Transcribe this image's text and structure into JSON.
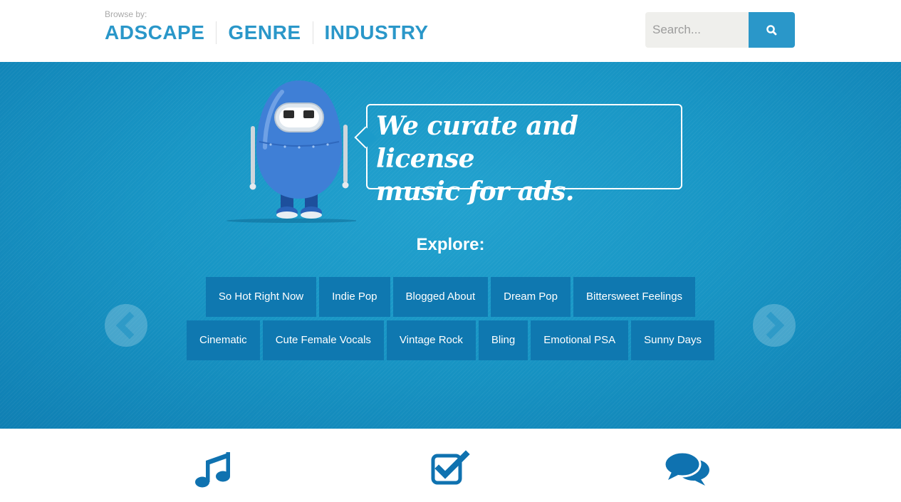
{
  "header": {
    "browse_label": "Browse by:",
    "nav": [
      "ADSCAPE",
      "GENRE",
      "INDUSTRY"
    ],
    "search": {
      "placeholder": "Search...",
      "button_icon": "search-icon"
    }
  },
  "hero": {
    "tagline_line1": "We curate and license",
    "tagline_line2": "music for ads.",
    "explore_label": "Explore:",
    "tags_row1": [
      "So Hot Right Now",
      "Indie Pop",
      "Blogged About",
      "Dream Pop",
      "Bittersweet Feelings"
    ],
    "tags_row2": [
      "Cinematic",
      "Cute Female Vocals",
      "Vintage Rock",
      "Bling",
      "Emotional PSA",
      "Sunny Days"
    ],
    "prev_icon": "chevron-left-icon",
    "next_icon": "chevron-right-icon",
    "mascot_icon": "robot-mascot"
  },
  "features": {
    "icons": [
      "music-note-icon",
      "checkbox-icon",
      "chat-bubbles-icon"
    ]
  },
  "colors": {
    "brand_blue": "#2a97c9",
    "hero_blue": "#1896c5",
    "tag_blue": "#0f78b0",
    "icon_blue": "#0f72b0",
    "search_bg": "#efefec"
  }
}
